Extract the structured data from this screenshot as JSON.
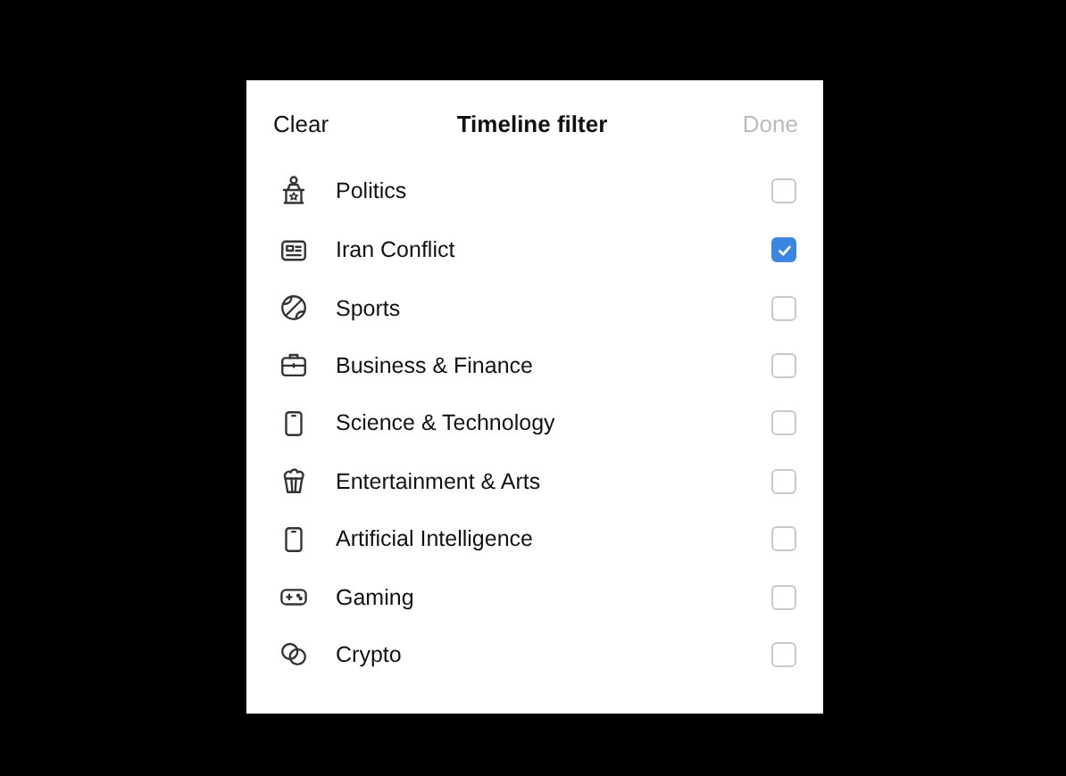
{
  "header": {
    "left_action": "Clear",
    "title": "Timeline filter",
    "right_action": "Done",
    "right_disabled": true
  },
  "topics": [
    {
      "label": "Politics",
      "checked": false
    },
    {
      "label": "Iran Conflict",
      "checked": true
    },
    {
      "label": "Sports",
      "checked": false
    },
    {
      "label": "Business & Finance",
      "checked": false
    },
    {
      "label": "Science & Technology",
      "checked": false
    },
    {
      "label": "Entertainment & Arts",
      "checked": false
    },
    {
      "label": "Artificial Intelligence",
      "checked": false
    },
    {
      "label": "Gaming",
      "checked": false
    },
    {
      "label": "Crypto",
      "checked": false
    }
  ]
}
